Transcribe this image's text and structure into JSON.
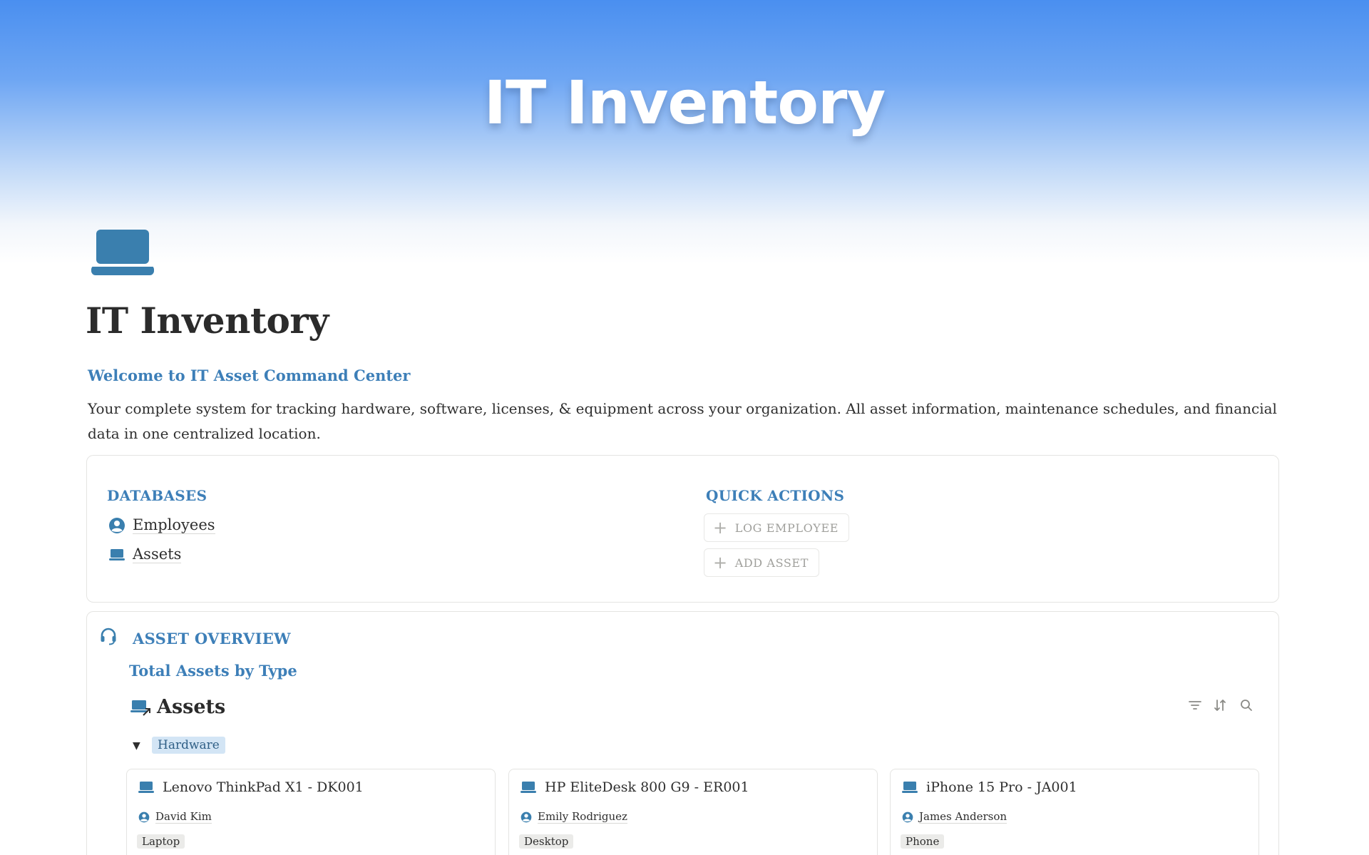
{
  "cover": {
    "title": "IT Inventory"
  },
  "page": {
    "icon": "laptop-icon",
    "title": "IT Inventory",
    "welcome": "Welcome to IT Asset Command Center",
    "description": "Your complete system for tracking hardware, software, licenses, & equipment across your organization. All asset information, maintenance schedules, and financial data in one centralized location."
  },
  "databases": {
    "heading": "DATABASES",
    "items": [
      {
        "label": "Employees",
        "icon": "person-icon"
      },
      {
        "label": "Assets",
        "icon": "laptop-icon"
      }
    ]
  },
  "quick_actions": {
    "heading": "QUICK ACTIONS",
    "buttons": [
      {
        "label": "LOG EMPLOYEE"
      },
      {
        "label": "ADD ASSET"
      }
    ]
  },
  "overview": {
    "heading": "ASSET OVERVIEW",
    "icon": "headset-icon",
    "subheading": "Total Assets by Type",
    "database_title": "Assets",
    "toolbar": [
      "filter-icon",
      "sort-icon",
      "search-icon"
    ],
    "group_label": "Hardware",
    "cards": [
      {
        "title": "Lenovo ThinkPad X1 - DK001",
        "person": "David Kim",
        "type": "Laptop"
      },
      {
        "title": "HP EliteDesk 800 G9 - ER001",
        "person": "Emily Rodriguez",
        "type": "Desktop"
      },
      {
        "title": "iPhone 15 Pro - JA001",
        "person": "James Anderson",
        "type": "Phone"
      }
    ]
  },
  "colors": {
    "accent": "#3d7fb8",
    "icon_blue": "#3a7fae",
    "tag_bg": "#d3e5f5"
  }
}
